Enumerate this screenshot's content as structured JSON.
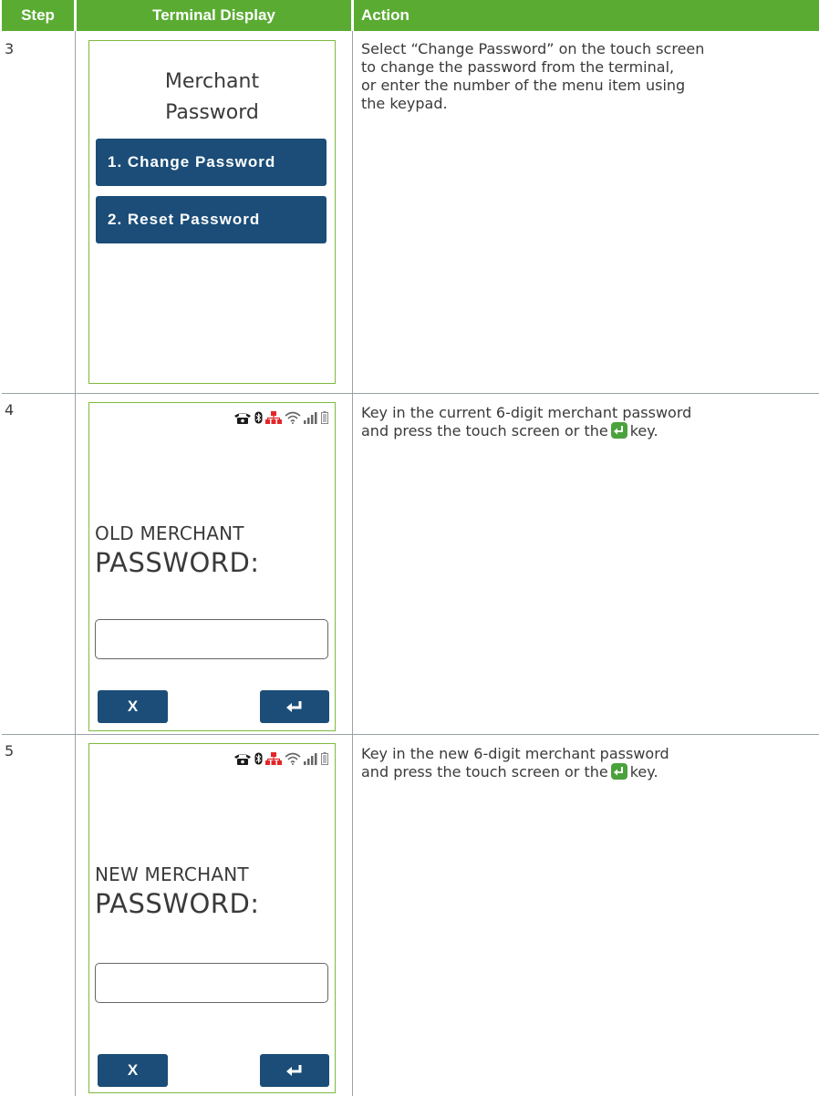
{
  "header": {
    "step": "Step",
    "display": "Terminal Display",
    "action": "Action"
  },
  "colors": {
    "header_green": "#5aab32",
    "button_blue": "#1b4d78",
    "screen_border": "#7dbb3e",
    "enter_key_green": "#4aa23c"
  },
  "rows": [
    {
      "step": "3",
      "screen": {
        "title_line1": "Merchant",
        "title_line2": "Password",
        "buttons": [
          "1. Change Password",
          "2. Reset Password"
        ]
      },
      "action_lines": [
        "Select “Change Password” on the touch screen",
        "to change the password from the terminal,",
        "or enter the number of the menu item using",
        "the keypad."
      ]
    },
    {
      "step": "4",
      "screen": {
        "status_icons": [
          "phone-icon",
          "bluetooth-icon",
          "ethernet-icon",
          "wifi-icon",
          "signal-bars-icon",
          "battery-icon"
        ],
        "label_line1": "OLD MERCHANT",
        "label_line2": "PASSWORD:",
        "cancel_label": "X",
        "enter_icon": "enter-arrow-icon"
      },
      "action_line1": "Key in the current 6-digit merchant password",
      "action_line2_pre": "and press the touch screen or the",
      "action_line2_post": "key."
    },
    {
      "step": "5",
      "screen": {
        "status_icons": [
          "phone-icon",
          "bluetooth-icon",
          "ethernet-icon",
          "wifi-icon",
          "signal-bars-icon",
          "battery-icon"
        ],
        "label_line1": "NEW MERCHANT",
        "label_line2": "PASSWORD:",
        "cancel_label": "X",
        "enter_icon": "enter-arrow-icon"
      },
      "action_line1": "Key in the new 6-digit merchant password",
      "action_line2_pre": "and press the touch screen or the",
      "action_line2_post": "key."
    }
  ]
}
